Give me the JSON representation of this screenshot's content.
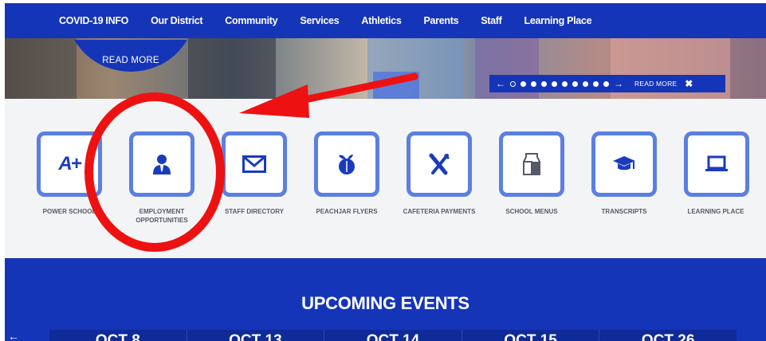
{
  "nav": {
    "items": [
      "COVID-19 INFO",
      "Our District",
      "Community",
      "Services",
      "Athletics",
      "Parents",
      "Staff",
      "Learning Place"
    ]
  },
  "hero": {
    "read_more_circle": "READ MORE",
    "scroll_arrow": "↓",
    "slider": {
      "prev": "←",
      "next": "→",
      "read_more": "READ MORE",
      "close": "✖",
      "dot_count": 10,
      "active_dot": 0
    }
  },
  "quick_links": [
    {
      "label": "POWER SCHOOL",
      "icon": "power-school-icon",
      "glyph": "A+"
    },
    {
      "label": "EMPLOYMENT OPPORTUNITIES",
      "icon": "person-icon",
      "glyph": ""
    },
    {
      "label": "STAFF DIRECTORY",
      "icon": "envelope-icon",
      "glyph": "✉"
    },
    {
      "label": "PEACHJAR FLYERS",
      "icon": "peach-icon",
      "glyph": ""
    },
    {
      "label": "CAFETERIA PAYMENTS",
      "icon": "fork-knife-icon",
      "glyph": ""
    },
    {
      "label": "SCHOOL MENUS",
      "icon": "milk-carton-icon",
      "glyph": ""
    },
    {
      "label": "TRANSCRIPTS",
      "icon": "graduation-cap-icon",
      "glyph": "🎓"
    },
    {
      "label": "LEARNING PLACE",
      "icon": "laptop-icon",
      "glyph": ""
    }
  ],
  "events": {
    "title": "UPCOMING EVENTS",
    "prev": "←",
    "dates": [
      "OCT 8",
      "OCT 13",
      "OCT 14",
      "OCT 15",
      "OCT 26"
    ]
  },
  "colors": {
    "brand_blue": "#1535b8",
    "tile_border": "#5b7fe2",
    "annotation_red": "#ee1111"
  }
}
